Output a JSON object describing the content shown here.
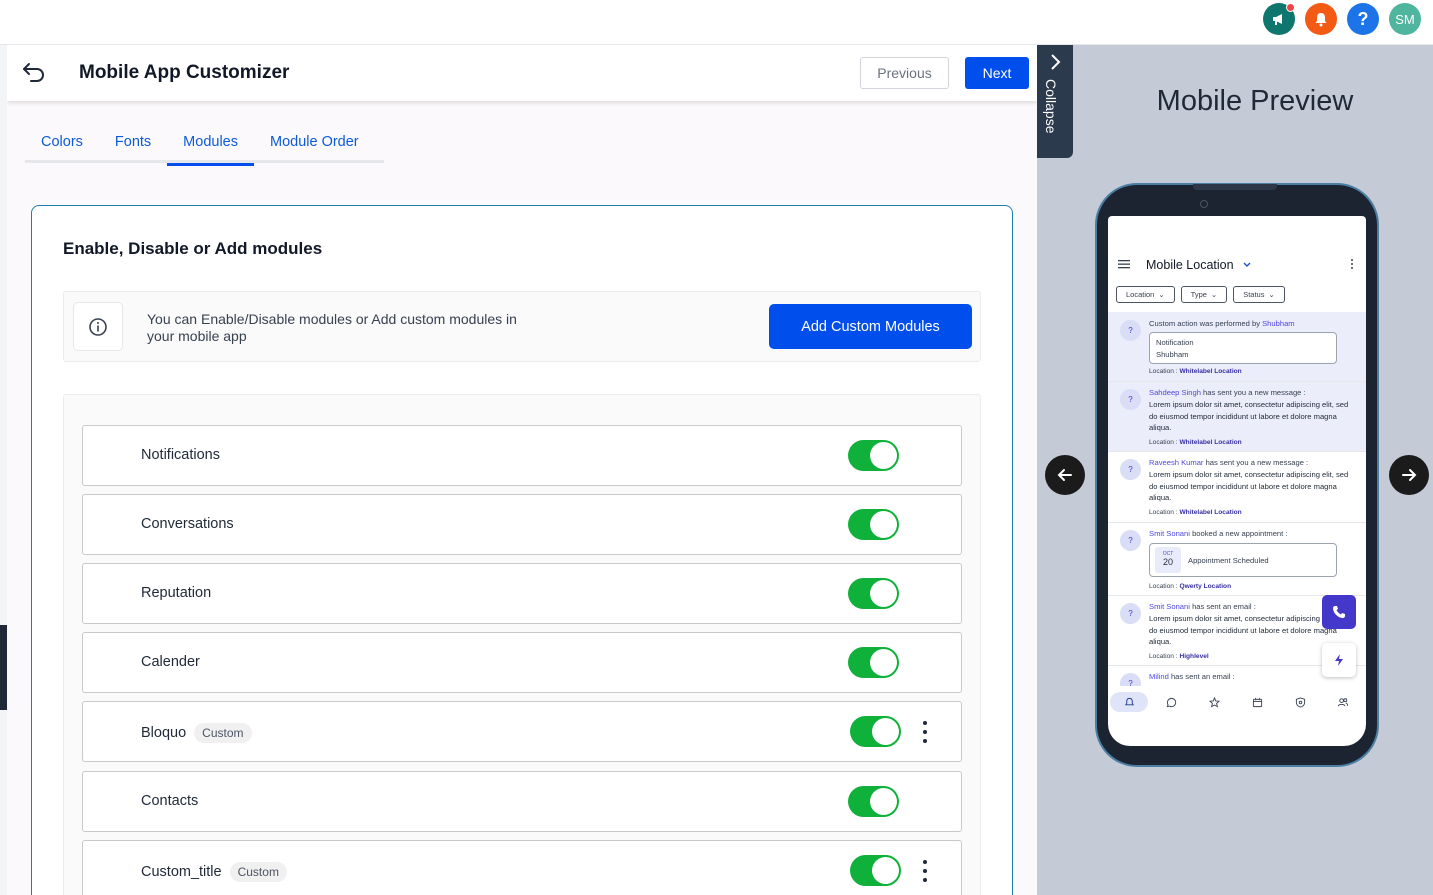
{
  "topbar": {
    "icons": [
      {
        "name": "megaphone-icon",
        "color": "#0f766e"
      },
      {
        "name": "bell-icon",
        "color": "#f35a14"
      },
      {
        "name": "help-icon",
        "color": "#1d74e8",
        "glyph": "?"
      },
      {
        "name": "user-avatar",
        "color": "#4fb59e",
        "initials": "SM"
      }
    ]
  },
  "header": {
    "title": "Mobile App Customizer",
    "previous_label": "Previous",
    "next_label": "Next"
  },
  "tabs": [
    {
      "label": "Colors",
      "active": false
    },
    {
      "label": "Fonts",
      "active": false
    },
    {
      "label": "Modules",
      "active": true
    },
    {
      "label": "Module Order",
      "active": false
    }
  ],
  "card": {
    "title": "Enable, Disable or Add modules",
    "info_text": "You can Enable/Disable modules or Add custom modules in your mobile app",
    "add_button_label": "Add Custom Modules"
  },
  "modules": [
    {
      "label": "Notifications",
      "custom": false,
      "enabled": true
    },
    {
      "label": "Conversations",
      "custom": false,
      "enabled": true
    },
    {
      "label": "Reputation",
      "custom": false,
      "enabled": true
    },
    {
      "label": "Calender",
      "custom": false,
      "enabled": true
    },
    {
      "label": "Bloquo",
      "custom": true,
      "badge": "Custom",
      "enabled": true
    },
    {
      "label": "Contacts",
      "custom": false,
      "enabled": true
    },
    {
      "label": "Custom_title",
      "custom": true,
      "badge": "Custom",
      "enabled": true
    }
  ],
  "preview": {
    "collapse_label": "Collapse",
    "title": "Mobile Preview",
    "app_title": "Mobile Location",
    "filters": [
      "Location",
      "Type",
      "Status"
    ],
    "feed": [
      {
        "name": "",
        "action": "Custom action was performed by ",
        "actor": "Shubham",
        "box_lines": [
          "Notification",
          "Shubham"
        ],
        "location_label": "Location : ",
        "location": "Whitelabel Location"
      },
      {
        "name": "Sahdeep Singh",
        "action": " has sent you a new message :",
        "body": "Lorem ipsum dolor sit amet, consectetur adipiscing elit, sed do eiusmod tempor incididunt ut labore et dolore magna aliqua.",
        "location_label": "Location : ",
        "location": "Whitelabel Location"
      },
      {
        "name": "Raveesh Kumar",
        "action": " has sent you a new message :",
        "body": "Lorem ipsum dolor sit amet, consectetur adipiscing elit, sed do eiusmod tempor incididunt ut labore et dolore magna aliqua.",
        "location_label": "Location : ",
        "location": "Whitelabel Location"
      },
      {
        "name": "Smit Sonani",
        "action": " booked a new appointment :",
        "date_month": "OCT",
        "date_day": "20",
        "box_text": "Appointment Scheduled",
        "location_label": "Location : ",
        "location": "Qwerty Location"
      },
      {
        "name": "Smit Sonani",
        "action": " has sent an email :",
        "body": "Lorem ipsum dolor sit amet, consectetur adipiscing elit, sed do eiusmod tempor incididunt ut labore et dolore magna aliqua.",
        "location_label": "Location : ",
        "location": "Highlevel"
      },
      {
        "name": "Milind",
        "action": " has sent an email :"
      }
    ],
    "bottom_nav": [
      "bell-icon",
      "chat-icon",
      "star-icon",
      "calendar-icon",
      "shield-icon",
      "contacts-icon"
    ]
  },
  "colors": {
    "primary": "#004eeb",
    "toggle_on": "#10b13a",
    "card_border": "#1e7fa8",
    "preview_bg": "#c4cbd6"
  }
}
